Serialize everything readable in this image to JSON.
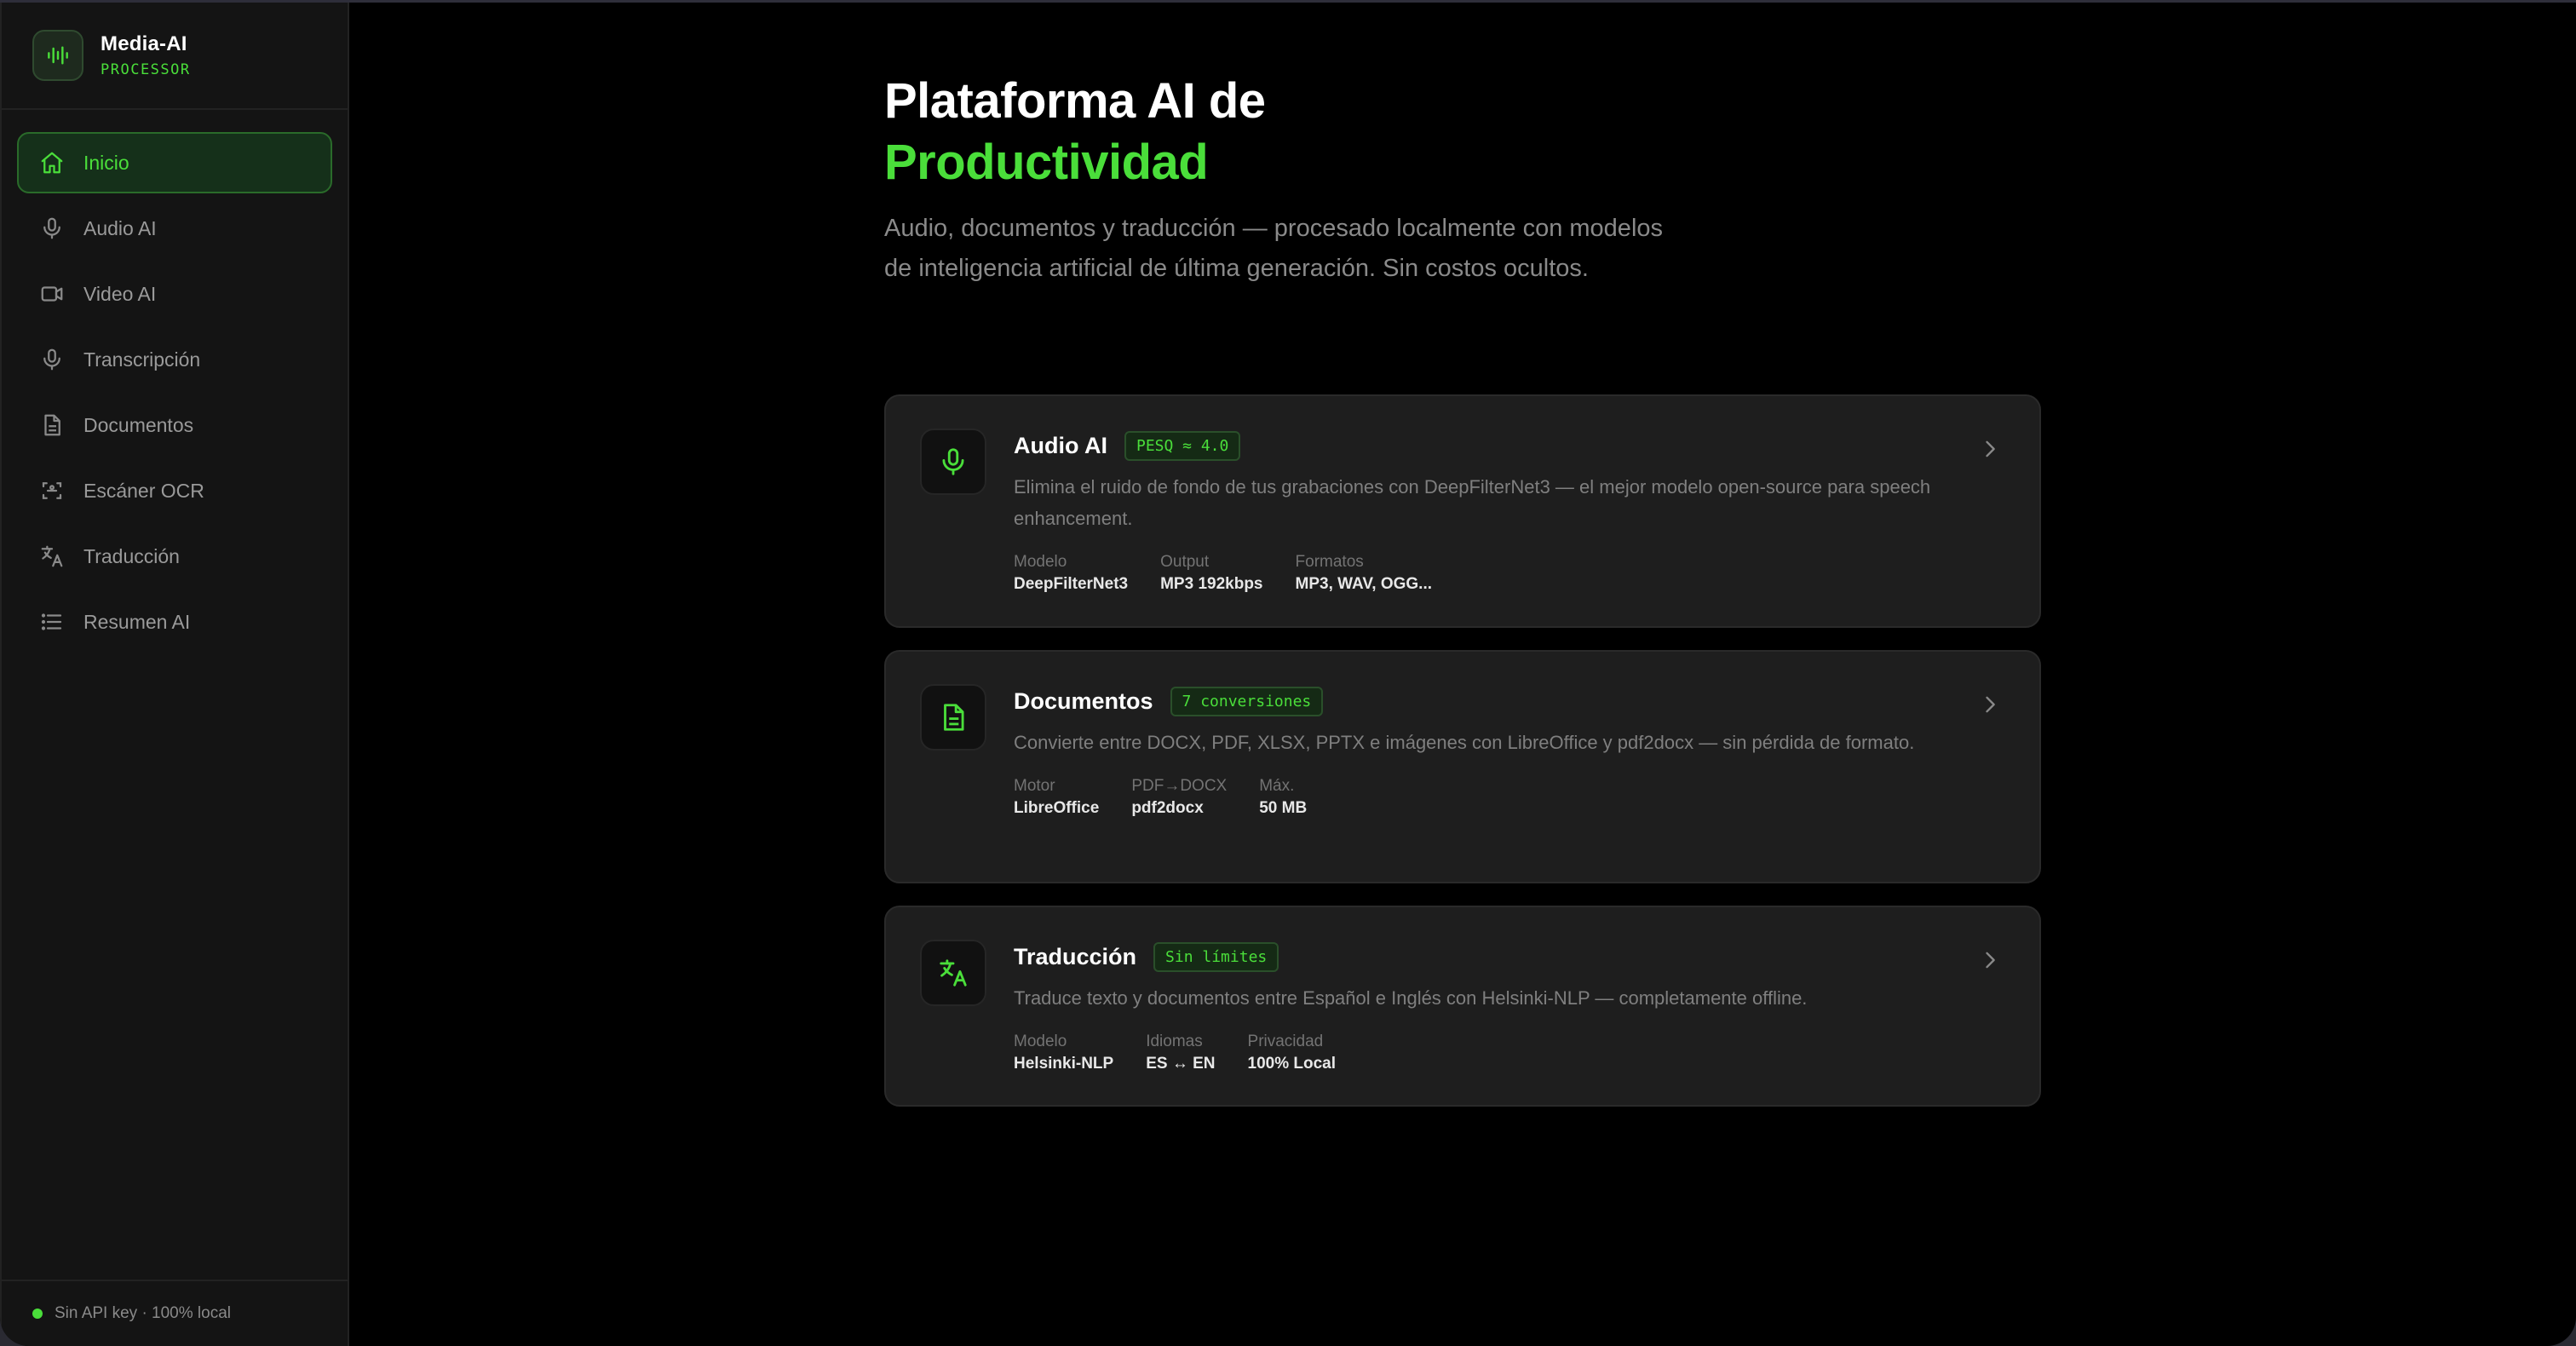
{
  "brand": {
    "name": "Media-AI",
    "subtitle": "PROCESSOR"
  },
  "sidebar": {
    "items": [
      {
        "label": "Inicio",
        "icon": "home-icon",
        "active": true
      },
      {
        "label": "Audio AI",
        "icon": "mic-icon"
      },
      {
        "label": "Video AI",
        "icon": "video-icon"
      },
      {
        "label": "Transcripción",
        "icon": "mic-icon"
      },
      {
        "label": "Documentos",
        "icon": "document-icon"
      },
      {
        "label": "Escáner OCR",
        "icon": "scan-icon"
      },
      {
        "label": "Traducción",
        "icon": "translate-icon"
      },
      {
        "label": "Resumen AI",
        "icon": "list-icon"
      }
    ],
    "footer": "Sin API key · 100% local"
  },
  "hero": {
    "title_line1": "Plataforma AI de",
    "title_line2": "Productividad",
    "description": "Audio, documentos y traducción — procesado localmente con modelos de inteligencia artificial de última generación. Sin costos ocultos."
  },
  "cards": [
    {
      "title": "Audio AI",
      "badge": "PESQ ≈ 4.0",
      "icon": "mic-icon",
      "description": "Elimina el ruido de fondo de tus grabaciones con DeepFilterNet3 — el mejor modelo open-source para speech enhancement.",
      "meta": [
        {
          "label": "Modelo",
          "value": "DeepFilterNet3"
        },
        {
          "label": "Output",
          "value": "MP3 192kbps"
        },
        {
          "label": "Formatos",
          "value": "MP3, WAV, OGG..."
        }
      ]
    },
    {
      "title": "Documentos",
      "badge": "7 conversiones",
      "icon": "document-icon",
      "description": "Convierte entre DOCX, PDF, XLSX, PPTX e imágenes con LibreOffice y pdf2docx — sin pérdida de formato.",
      "meta": [
        {
          "label": "Motor",
          "value": "LibreOffice"
        },
        {
          "label": "PDF→DOCX",
          "value": "pdf2docx"
        },
        {
          "label": "Máx.",
          "value": "50 MB"
        }
      ]
    },
    {
      "title": "Traducción",
      "badge": "Sin límites",
      "icon": "translate-icon",
      "description": "Traduce texto y documentos entre Español e Inglés con Helsinki-NLP — completamente offline.",
      "meta": [
        {
          "label": "Modelo",
          "value": "Helsinki-NLP"
        },
        {
          "label": "Idiomas",
          "value": "ES ↔ EN"
        },
        {
          "label": "Privacidad",
          "value": "100% Local"
        }
      ]
    }
  ],
  "colors": {
    "accent": "#4ade3a",
    "background": "#000000",
    "card": "#1e1e1e"
  }
}
